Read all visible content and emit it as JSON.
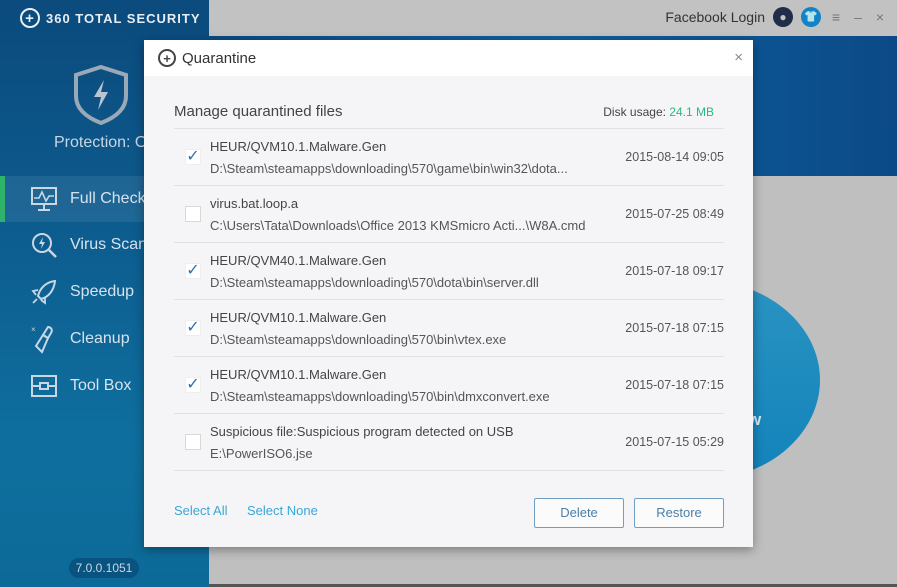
{
  "app": {
    "brand": "360 TOTAL SECURITY",
    "protection": "Protection: O",
    "version": "7.0.0.1051",
    "circle_text": "w"
  },
  "topbar": {
    "login": "Facebook Login",
    "menu": "≡",
    "minimize": "–",
    "close": "×"
  },
  "sidebar": {
    "items": [
      {
        "label": "Full Check",
        "icon": "monitor-pulse-icon",
        "active": true
      },
      {
        "label": "Virus Scan",
        "icon": "virus-scan-icon",
        "active": false
      },
      {
        "label": "Speedup",
        "icon": "rocket-icon",
        "active": false
      },
      {
        "label": "Cleanup",
        "icon": "broom-icon",
        "active": false
      },
      {
        "label": "Tool Box",
        "icon": "toolbox-icon",
        "active": false
      }
    ]
  },
  "dialog": {
    "title": "Quarantine",
    "close": "×",
    "heading": "Manage quarantined files",
    "disk_label": "Disk usage: ",
    "disk_value": "24.1 MB",
    "colors": {
      "disk": "#2db87d",
      "link": "#3aa6d8",
      "active_nav": "#2fb36b"
    },
    "files": [
      {
        "name": "HEUR/QVM10.1.Malware.Gen",
        "path": "D:\\Steam\\steamapps\\downloading\\570\\game\\bin\\win32\\dota...",
        "date": "2015-08-14 09:05",
        "checked": true
      },
      {
        "name": "virus.bat.loop.a",
        "path": "C:\\Users\\Tata\\Downloads\\Office 2013 KMSmicro Acti...\\W8A.cmd",
        "date": "2015-07-25 08:49",
        "checked": false
      },
      {
        "name": "HEUR/QVM40.1.Malware.Gen",
        "path": "D:\\Steam\\steamapps\\downloading\\570\\dota\\bin\\server.dll",
        "date": "2015-07-18 09:17",
        "checked": true
      },
      {
        "name": "HEUR/QVM10.1.Malware.Gen",
        "path": "D:\\Steam\\steamapps\\downloading\\570\\bin\\vtex.exe",
        "date": "2015-07-18 07:15",
        "checked": true
      },
      {
        "name": "HEUR/QVM10.1.Malware.Gen",
        "path": "D:\\Steam\\steamapps\\downloading\\570\\bin\\dmxconvert.exe",
        "date": "2015-07-18 07:15",
        "checked": true
      },
      {
        "name": "Suspicious file:Suspicious program detected on USB",
        "path": "E:\\PowerISO6.jse",
        "date": "2015-07-15 05:29",
        "checked": false
      }
    ],
    "select_all": "Select All",
    "select_none": "Select None",
    "delete": "Delete",
    "restore": "Restore"
  }
}
